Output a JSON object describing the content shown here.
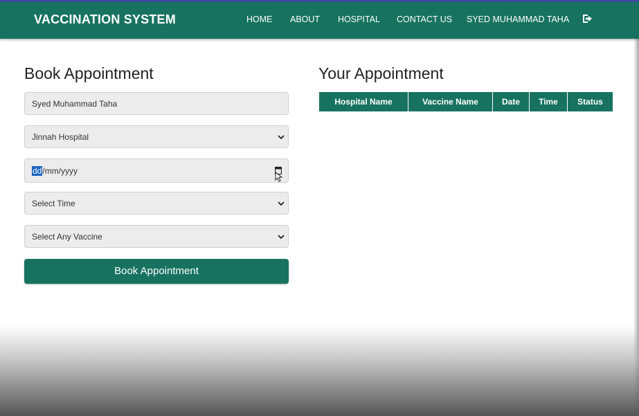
{
  "navbar": {
    "brand": "VACCINATION SYSTEM",
    "links": [
      {
        "label": "HOME"
      },
      {
        "label": "ABOUT"
      },
      {
        "label": "HOSPITAL"
      },
      {
        "label": "CONTACT US"
      },
      {
        "label": "SYED MUHAMMAD TAHA"
      }
    ],
    "logout_icon": "sign-out-icon"
  },
  "booking": {
    "title": "Book Appointment",
    "name_value": "Syed Muhammad Taha",
    "hospital_selected": "Jinnah Hospital",
    "date_segments": {
      "day": "dd",
      "rest": "/mm/yyyy"
    },
    "time_selected": "Select Time",
    "vaccine_selected": "Select Any Vaccine",
    "submit_label": "Book Appointment"
  },
  "appointments": {
    "title": "Your Appointment",
    "columns": [
      "Hospital Name",
      "Vaccine Name",
      "Date",
      "Time",
      "Status"
    ]
  },
  "colors": {
    "primary": "#17735f",
    "field_bg": "#ececec",
    "selection": "#1a62c0"
  }
}
